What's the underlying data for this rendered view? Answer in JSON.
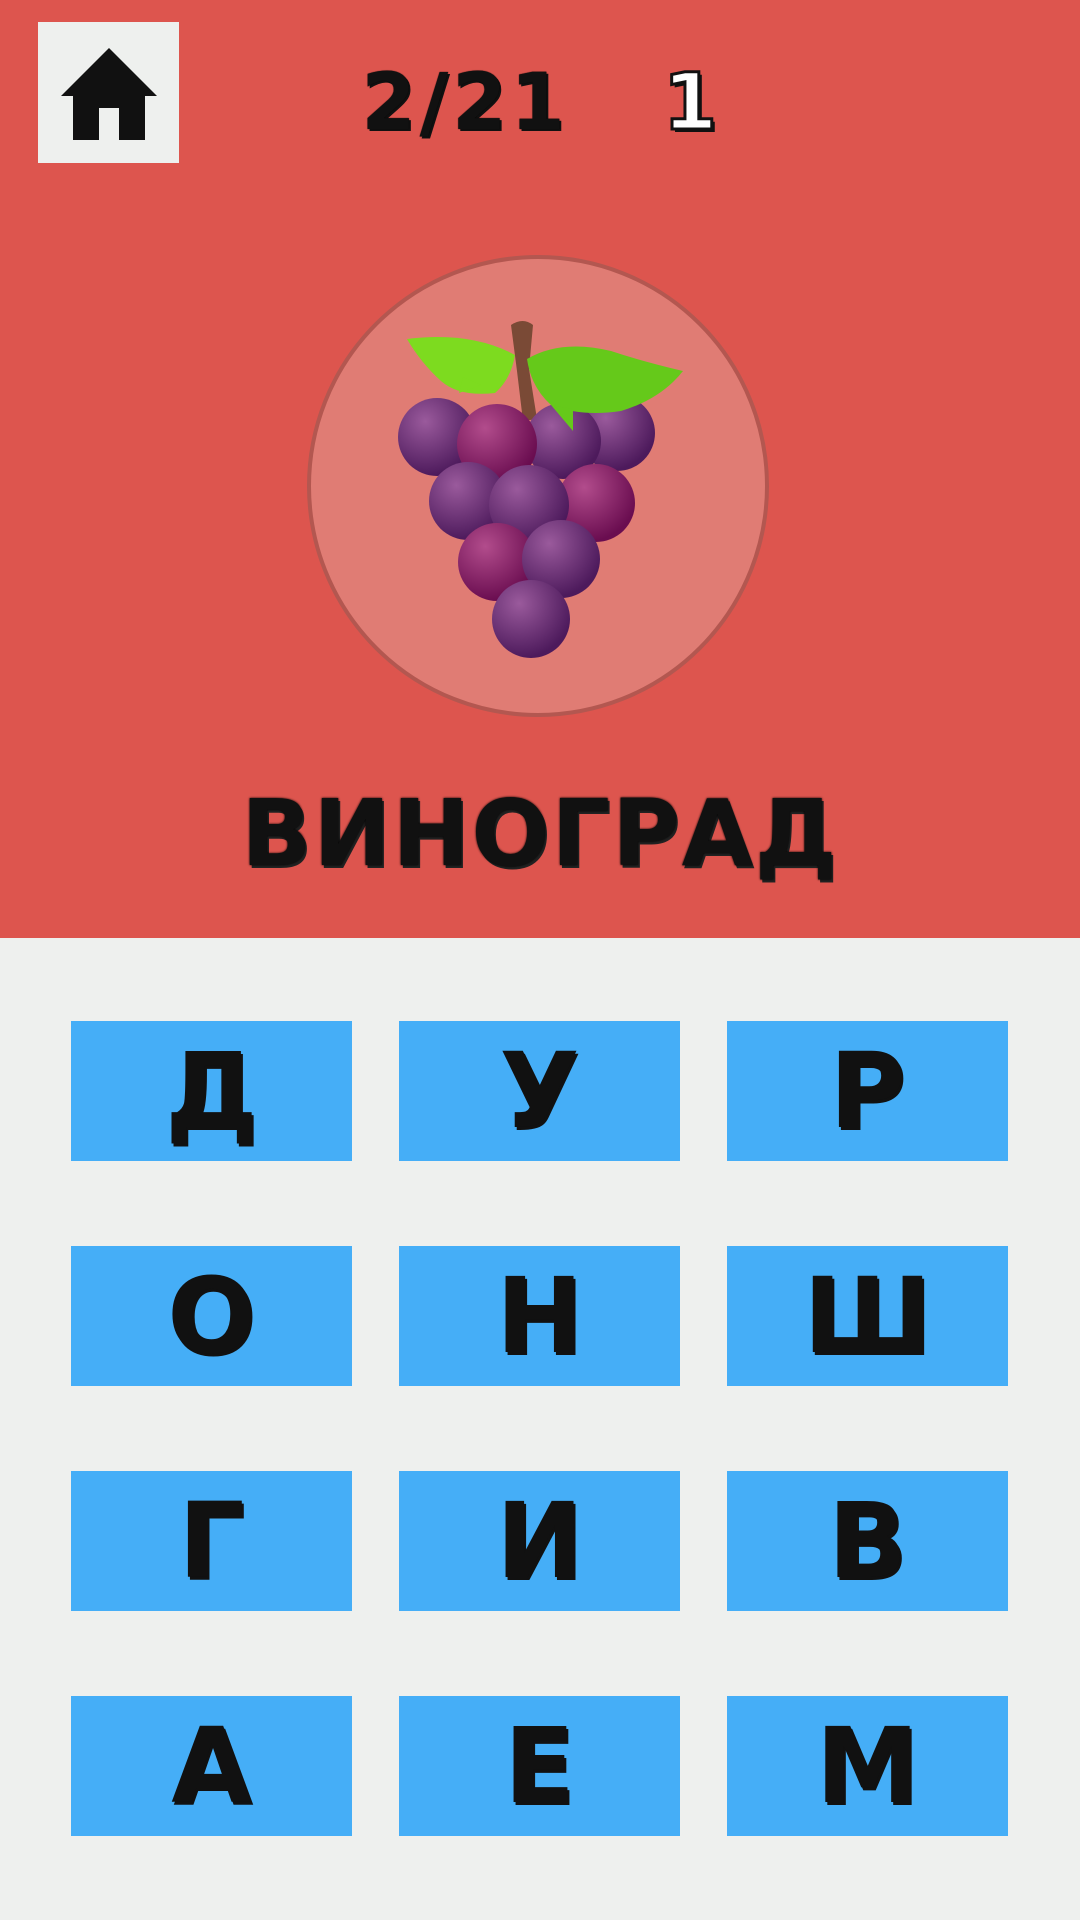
{
  "header": {
    "progress": "2/21",
    "score": "1"
  },
  "picture": {
    "icon": "grapes-icon"
  },
  "word": "ВИНОГРАД",
  "letters": [
    "Д",
    "У",
    "Р",
    "О",
    "Н",
    "Ш",
    "Г",
    "И",
    "В",
    "А",
    "Е",
    "М"
  ],
  "colors": {
    "top_background": "#dd554e",
    "bottom_background": "#eef0ee",
    "letter_button": "#45aef7",
    "circle_fill": "#e07c74"
  }
}
